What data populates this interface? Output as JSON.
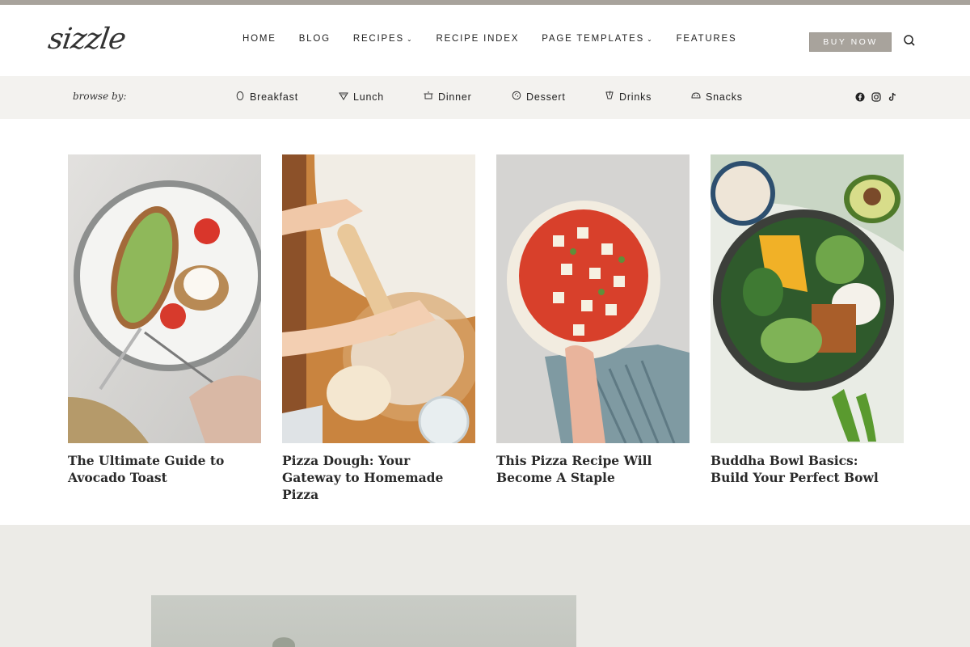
{
  "brand": {
    "logo_text": "sizzle"
  },
  "nav": {
    "items": [
      {
        "label": "HOME",
        "dropdown": false
      },
      {
        "label": "BLOG",
        "dropdown": false
      },
      {
        "label": "RECIPES",
        "dropdown": true
      },
      {
        "label": "RECIPE INDEX",
        "dropdown": false
      },
      {
        "label": "PAGE TEMPLATES",
        "dropdown": true
      },
      {
        "label": "FEATURES",
        "dropdown": false
      }
    ],
    "buy_label": "BUY NOW"
  },
  "browse": {
    "label": "browse by:",
    "categories": [
      {
        "label": "Breakfast",
        "icon": "egg-icon"
      },
      {
        "label": "Lunch",
        "icon": "taco-icon"
      },
      {
        "label": "Dinner",
        "icon": "pot-icon"
      },
      {
        "label": "Dessert",
        "icon": "cookie-icon"
      },
      {
        "label": "Drinks",
        "icon": "drink-icon"
      },
      {
        "label": "Snacks",
        "icon": "snack-icon"
      }
    ],
    "social": [
      "facebook-icon",
      "instagram-icon",
      "tiktok-icon"
    ]
  },
  "cards": [
    {
      "title": "The Ultimate Guide to Avocado Toast"
    },
    {
      "title": "Pizza Dough: Your Gateway to Homemade Pizza"
    },
    {
      "title": "This Pizza Recipe Will Become A Staple"
    },
    {
      "title": "Buddha Bowl Basics: Build Your Perfect Bowl"
    }
  ],
  "colors": {
    "accent": "#a8a39c",
    "browse_bg": "#f3f2ef",
    "bottom_bg": "#ecebe7"
  }
}
